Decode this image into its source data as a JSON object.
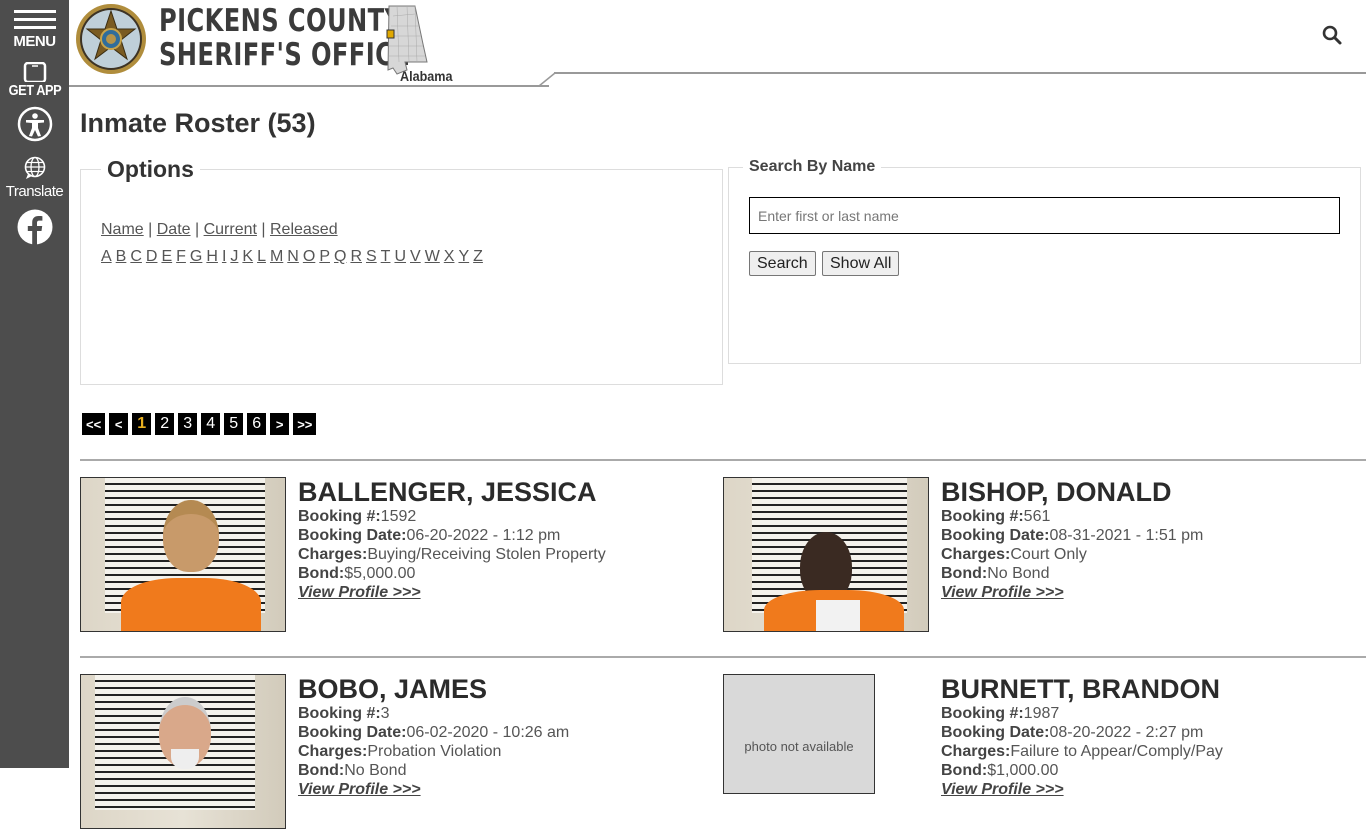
{
  "sidebar": {
    "menu_label": "MENU",
    "get_app_label": "GET APP",
    "translate_label": "Translate",
    "icons": [
      "menu-icon",
      "phone-icon",
      "accessibility-icon",
      "globe-icon",
      "facebook-icon"
    ]
  },
  "header": {
    "title_line1": "PICKENS COUNTY",
    "title_line2": "SHERIFF'S OFFICE",
    "state_label": "Alabama",
    "colors": {
      "title": "#3b3b3b",
      "highlight_county": "#e0a800"
    }
  },
  "page": {
    "title": "Inmate Roster (53)"
  },
  "options": {
    "legend": "Options",
    "sort_links": [
      "Name",
      "Date",
      "Current",
      "Released"
    ],
    "letters": [
      "A",
      "B",
      "C",
      "D",
      "E",
      "F",
      "G",
      "H",
      "I",
      "J",
      "K",
      "L",
      "M",
      "N",
      "O",
      "P",
      "Q",
      "R",
      "S",
      "T",
      "U",
      "V",
      "W",
      "X",
      "Y",
      "Z"
    ]
  },
  "search": {
    "legend": "Search By Name",
    "input_value": "",
    "placeholder": "Enter first or last name",
    "search_button": "Search",
    "show_all_button": "Show All"
  },
  "pagination": {
    "first": "<<",
    "prev": "<",
    "pages": [
      "1",
      "2",
      "3",
      "4",
      "5",
      "6"
    ],
    "current_page": "1",
    "next": ">",
    "last": ">>",
    "current_color": "#e8b020"
  },
  "labels": {
    "booking_no": "Booking #:",
    "booking_date": "Booking Date:",
    "charges": "Charges:",
    "bond": "Bond:",
    "view_profile": "View Profile >>>",
    "photo_not_available": "photo not available"
  },
  "inmates": [
    {
      "name": "BALLENGER, JESSICA",
      "booking_no": "1592",
      "booking_date": "06-20-2022 - 1:12 pm",
      "charges": "Buying/Receiving Stolen Property",
      "bond": "$5,000.00",
      "photo": "mugshot"
    },
    {
      "name": "BISHOP, DONALD",
      "booking_no": "561",
      "booking_date": "08-31-2021 - 1:51 pm",
      "charges": "Court Only",
      "bond": "No Bond",
      "photo": "mugshot"
    },
    {
      "name": "BOBO, JAMES",
      "booking_no": "3",
      "booking_date": "06-02-2020 - 10:26 am",
      "charges": "Probation Violation",
      "bond": "No Bond",
      "photo": "mugshot"
    },
    {
      "name": "BURNETT, BRANDON",
      "booking_no": "1987",
      "booking_date": "08-20-2022 - 2:27 pm",
      "charges": "Failure to Appear/Comply/Pay",
      "bond": "$1,000.00",
      "photo": "not-available"
    }
  ]
}
